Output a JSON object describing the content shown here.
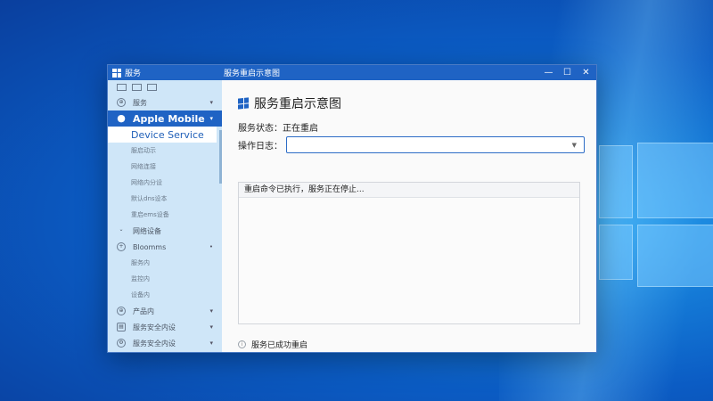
{
  "window": {
    "app_name": "服务",
    "title": "服务重启示意图",
    "controls": {
      "minimize": "—",
      "maximize": "☐",
      "close": "✕"
    }
  },
  "sidebar": {
    "items": [
      {
        "label": "服务",
        "icon": "service-icon",
        "chevron": "▾"
      },
      {
        "label": "Apple Mobile",
        "icon": "apple-icon",
        "chevron": "▾",
        "active": true
      },
      {
        "label": "Device Service",
        "selected": true
      },
      {
        "label": "服启动示"
      },
      {
        "label": "网络连接"
      },
      {
        "label": "网络内分设"
      },
      {
        "label": "默认dns设本"
      },
      {
        "label": "重启ems设备"
      },
      {
        "label": "网络设备",
        "icon": "chevron-icon"
      },
      {
        "label": "Bloomms",
        "icon": "plus-icon",
        "chevron": "•"
      },
      {
        "label": "服务内"
      },
      {
        "label": "监控内"
      },
      {
        "label": "设备内"
      },
      {
        "label": "产品内",
        "icon": "product-icon",
        "chevron": "▾"
      },
      {
        "label": "服务安全内设",
        "icon": "security-icon",
        "chevron": "▾"
      },
      {
        "label": "服务安全内设",
        "icon": "settings-icon",
        "chevron": "▾"
      }
    ]
  },
  "main": {
    "title": "服务重启示意图",
    "status_label": "服务状态：",
    "status_value": "正在重启",
    "log_label": "操作日志：",
    "log_value": "",
    "panel_text": "重启命令已执行，服务正在停止...",
    "result_text": "服务已成功重启"
  },
  "colors": {
    "accent": "#1f63c4",
    "sidebar_bg": "#cfe6f8",
    "desktop": "#0b5cc4"
  }
}
